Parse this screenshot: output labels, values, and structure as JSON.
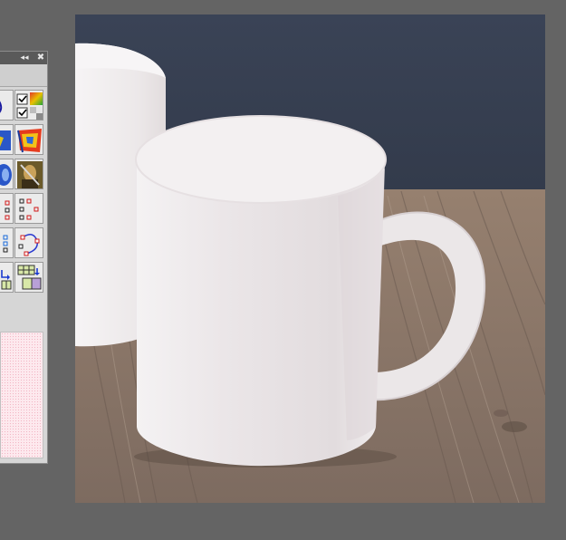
{
  "palette": {
    "collapse_glyph": "◂◂",
    "close_glyph": "✖",
    "tools": [
      {
        "name": "draw-curve-tool",
        "icon": "curve-arrow-icon"
      },
      {
        "name": "color-swatch-tool",
        "icon": "color-gradient-icon",
        "checked": true
      },
      {
        "name": "gray-swatch-tool",
        "icon": "gray-squares-icon",
        "checked": true
      },
      {
        "name": "color-map-tool",
        "icon": "color-map-icon"
      },
      {
        "name": "heatmap-tool",
        "icon": "heatmap-icon"
      },
      {
        "name": "blend-tool",
        "icon": "blend-icon"
      },
      {
        "name": "portrait-image-tool",
        "icon": "portrait-icon"
      },
      {
        "name": "point-grid-tool",
        "icon": "point-grid-icon"
      },
      {
        "name": "point-pattern-tool",
        "icon": "point-pattern-icon"
      },
      {
        "name": "scatter-points-tool",
        "icon": "scatter-points-icon"
      },
      {
        "name": "path-points-tool",
        "icon": "path-points-icon"
      },
      {
        "name": "grid-arrow-tool",
        "icon": "grid-arrow-icon"
      },
      {
        "name": "grid-fill-tool",
        "icon": "grid-fill-icon"
      }
    ]
  },
  "colors": {
    "desktop": "#646464",
    "wall": "#3b4455",
    "table": "#8a776a",
    "mug": "#efeceb"
  }
}
